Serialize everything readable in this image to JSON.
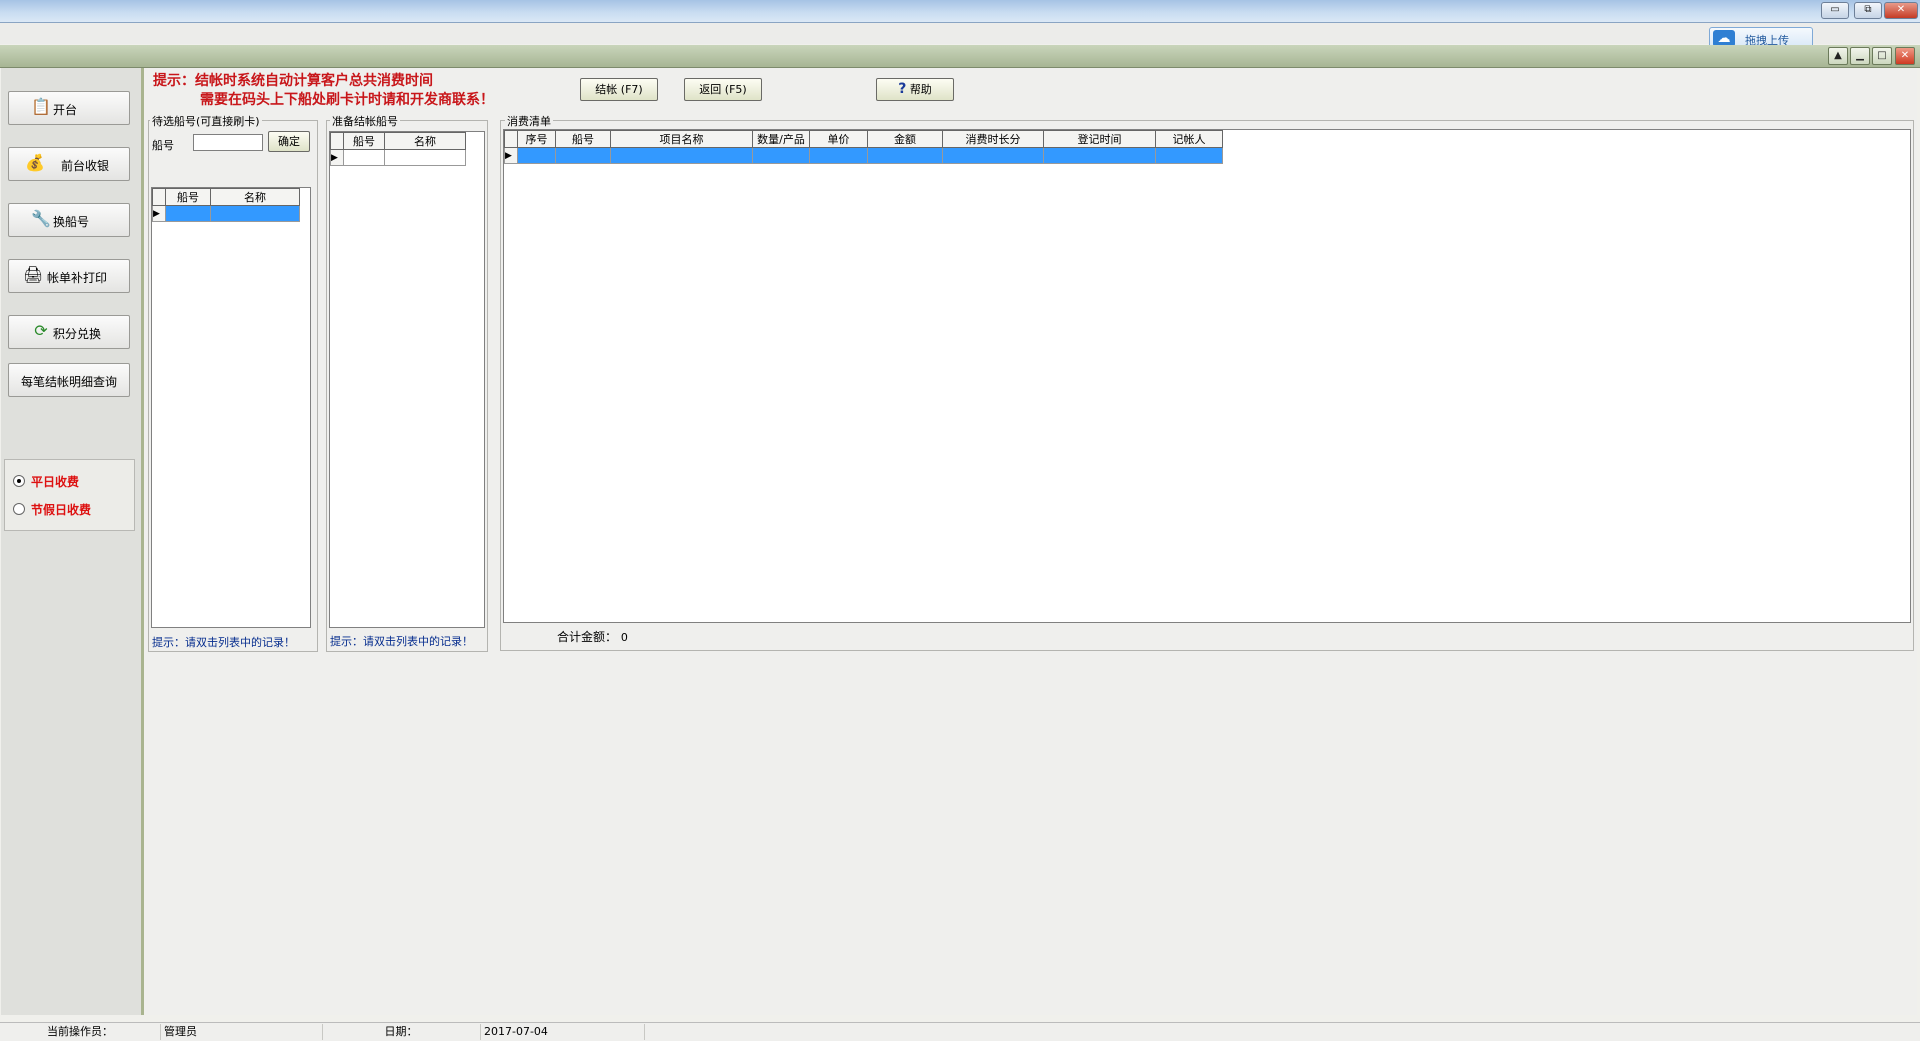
{
  "window": {
    "min_label": "▭",
    "max_label": "⧉",
    "close_label": "✕"
  },
  "upload": {
    "icon": "baidu-cloud-icon",
    "label": "拖拽上传"
  },
  "mdi": {
    "up_label": "▲",
    "min_label": "▁",
    "max_label": "□",
    "close_label": "✕"
  },
  "sidebar": {
    "items": [
      {
        "label": "开台",
        "icon": "open-table-icon",
        "glyph": "📋"
      },
      {
        "label": "前台收银",
        "icon": "money-bag-icon",
        "glyph": "💰"
      },
      {
        "label": "换船号",
        "icon": "swap-tools-icon",
        "glyph": "🔧"
      },
      {
        "label": "帐单补打印",
        "icon": "printer-icon",
        "glyph": "🖨"
      },
      {
        "label": "积分兑换",
        "icon": "points-exchange-icon",
        "glyph": "⟳"
      },
      {
        "label": "每笔结帐明细查询"
      }
    ],
    "fee_mode": {
      "options": [
        "平日收费",
        "节假日收费"
      ],
      "selected": "平日收费"
    }
  },
  "tip": {
    "line1": "提示：结帐时系统自动计算客户总共消费时间",
    "line2": "需要在码头上下船处刷卡计时请和开发商联系！"
  },
  "toolbar": {
    "checkout_label": "结帐 (F7)",
    "back_label": "返回 (F5)",
    "help_label": "帮助",
    "help_icon_glyph": "?"
  },
  "pending": {
    "title": "待选船号(可直接刷卡)",
    "boat_label": "船号",
    "boat_value": "",
    "confirm_label": "确定",
    "columns": [
      "船号",
      "名称"
    ],
    "hint": "提示：请双击列表中的记录！"
  },
  "ready": {
    "title": "准备结帐船号",
    "columns": [
      "船号",
      "名称"
    ],
    "hint": "提示：请双击列表中的记录！"
  },
  "consumption": {
    "title": "消费清单",
    "columns": [
      "序号",
      "船号",
      "项目名称",
      "数量/产品",
      "单价",
      "金额",
      "消费时长分",
      "登记时间",
      "记帐人"
    ],
    "total_label": "合计金额：",
    "total_value": "0"
  },
  "status": {
    "operator_label": "当前操作员：",
    "operator_value": "管理员",
    "date_label": "日期：",
    "date_value": "2017-07-04"
  }
}
